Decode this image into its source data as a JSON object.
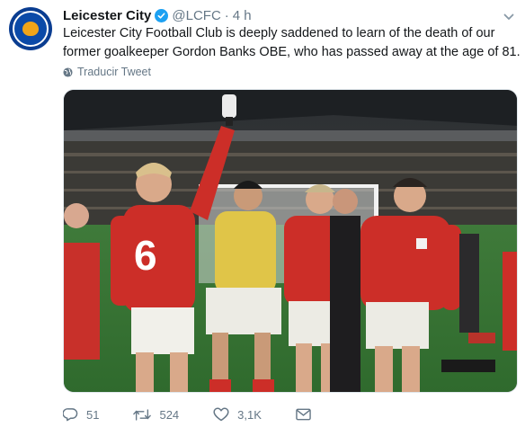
{
  "tweet": {
    "author_name": "Leicester City",
    "handle": "@LCFC",
    "separator": "·",
    "time": "4 h",
    "text_lines": [
      "Leicester City Football Club is deeply saddened to learn of the death of our",
      "former goalkeeper Gordon Banks OBE, who has passed away at the age of 81."
    ],
    "translate_label": "Traducir Tweet",
    "media_icon": "photo-of-footballers-celebrating",
    "shirt_number": "6",
    "actions": {
      "reply_count": "51",
      "retweet_count": "524",
      "like_count": "3,1K"
    },
    "icons": {
      "verified": "verified-badge-icon",
      "menu": "chevron-down-icon",
      "translate": "globe-icon",
      "reply": "reply-icon",
      "retweet": "retweet-icon",
      "like": "heart-icon",
      "dm": "envelope-icon"
    },
    "colors": {
      "verified": "#1da1f2",
      "secondary_text": "#657786",
      "primary_text": "#14171a",
      "club_blue": "#0a3d91"
    }
  }
}
